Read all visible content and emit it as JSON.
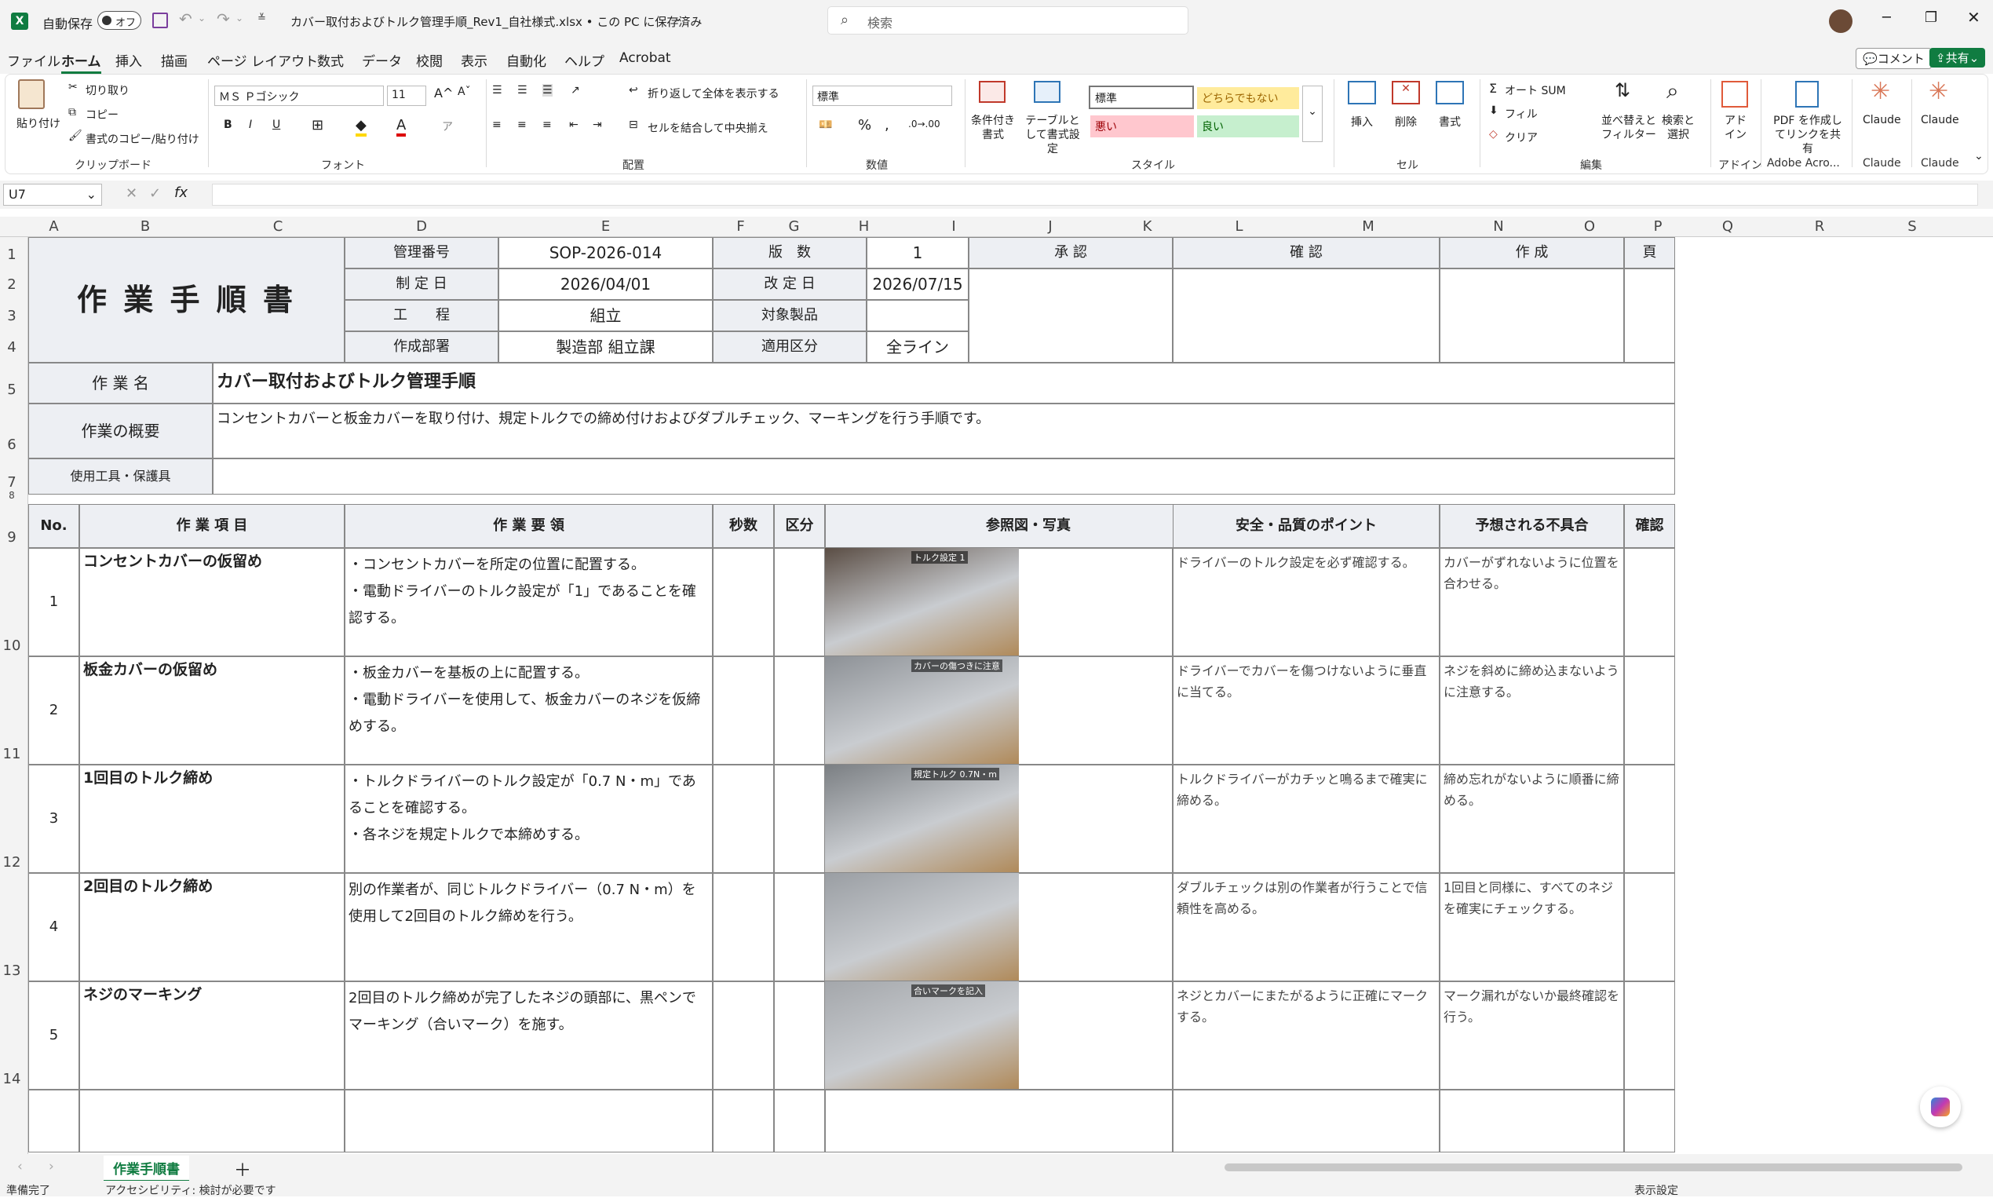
{
  "titlebar": {
    "autosave": "自動保存",
    "autosave_state": "オフ",
    "filename": "カバー取付およびトルク管理手順_Rev1_自社様式.xlsx • この PC に保存済み",
    "search_placeholder": "検索"
  },
  "menu": [
    "ファイル",
    "ホーム",
    "挿入",
    "描画",
    "ページ レイアウト",
    "数式",
    "データ",
    "校閲",
    "表示",
    "自動化",
    "ヘルプ",
    "Acrobat"
  ],
  "menu_right": {
    "comment": "コメント",
    "share": "共有"
  },
  "ribbon": {
    "clipboard": {
      "paste": "貼り付け",
      "cut": "切り取り",
      "copy": "コピー",
      "format_painter": "書式のコピー/貼り付け",
      "group": "クリップボード"
    },
    "font": {
      "name": "ＭＳ Ｐゴシック",
      "size": "11",
      "group": "フォント"
    },
    "align": {
      "wrap": "折り返して全体を表示する",
      "merge": "セルを結合して中央揃え",
      "group": "配置"
    },
    "number": {
      "format": "標準",
      "group": "数値"
    },
    "styles": {
      "cond": "条件付き書式",
      "table": "テーブルとして書式設定",
      "normal": "標準",
      "neutral": "どちらでもない",
      "bad": "悪い",
      "good": "良い",
      "group": "スタイル"
    },
    "cells": {
      "insert": "挿入",
      "delete": "削除",
      "format": "書式",
      "group": "セル"
    },
    "edit": {
      "autosum": "オート SUM",
      "fill": "フィル",
      "clear": "クリア",
      "sort": "並べ替えとフィルター",
      "find": "検索と選択",
      "group": "編集"
    },
    "addin": {
      "label": "アドイン",
      "group": "アドイン"
    },
    "pdf": {
      "label": "PDF を作成してリンクを共有",
      "group": "Adobe Acro..."
    },
    "claude1": {
      "label": "Claude",
      "group": "Claude"
    },
    "claude2": {
      "label": "Claude",
      "group": "Claude"
    }
  },
  "namebox": "U7",
  "columns": [
    "A",
    "B",
    "C",
    "D",
    "E",
    "F",
    "G",
    "H",
    "I",
    "J",
    "K",
    "L",
    "M",
    "N",
    "O",
    "P",
    "Q",
    "R",
    "S"
  ],
  "rows": [
    "1",
    "2",
    "3",
    "4",
    "5",
    "6",
    "7",
    "8",
    "9",
    "10",
    "11",
    "12",
    "13",
    "14"
  ],
  "header": {
    "doc_title": "作 業 手 順 書",
    "mgmt_no_label": "管理番号",
    "mgmt_no": "SOP-2026-014",
    "version_label": "版　数",
    "version": "1",
    "created_label": "制 定 日",
    "created": "2026/04/01",
    "revised_label": "改 定 日",
    "revised": "2026/07/15",
    "process_label": "工　　程",
    "process": "組立",
    "product_label": "対象製品",
    "product": "",
    "dept_label": "作成部署",
    "dept": "製造部 組立課",
    "scope_label": "適用区分",
    "scope": "全ライン",
    "approve": "承 認",
    "check": "確 認",
    "make": "作 成",
    "page": "頁"
  },
  "info": {
    "name_label": "作 業 名",
    "name": "カバー取付およびトルク管理手順",
    "summary_label": "作業の概要",
    "summary": "コンセントカバーと板金カバーを取り付け、規定トルクでの締め付けおよびダブルチェック、マーキングを行う手順です。",
    "tools_label": "使用工具・保護具",
    "tools": ""
  },
  "table_headers": {
    "no": "No.",
    "item": "作 業 項 目",
    "method": "作 業 要 領",
    "sec": "秒数",
    "kind": "区分",
    "ref": "参照図・写真",
    "safety": "安全・品質のポイント",
    "defect": "予想される不具合",
    "confirm": "確認"
  },
  "steps": [
    {
      "no": "1",
      "item": "コンセントカバーの仮留め",
      "method": "・コンセントカバーを所定の位置に配置する。\n・電動ドライバーのトルク設定が「1」であることを確認する。",
      "photo_caption": "トルク設定 1",
      "safety": "ドライバーのトルク設定を必ず確認する。",
      "defect": "カバーがずれないように位置を合わせる。"
    },
    {
      "no": "2",
      "item": "板金カバーの仮留め",
      "method": "・板金カバーを基板の上に配置する。\n・電動ドライバーを使用して、板金カバーのネジを仮締めする。",
      "photo_caption": "カバーの傷つきに注意",
      "safety": "ドライバーでカバーを傷つけないように垂直に当てる。",
      "defect": "ネジを斜めに締め込まないように注意する。"
    },
    {
      "no": "3",
      "item": "1回目のトルク締め",
      "method": "・トルクドライバーのトルク設定が「0.7 N・m」であることを確認する。\n・各ネジを規定トルクで本締めする。",
      "photo_caption": "規定トルク 0.7N・m",
      "safety": "トルクドライバーがカチッと鳴るまで確実に締める。",
      "defect": "締め忘れがないように順番に締める。"
    },
    {
      "no": "4",
      "item": "2回目のトルク締め",
      "method": "別の作業者が、同じトルクドライバー（0.7 N・m）を使用して2回目のトルク締めを行う。",
      "photo_caption": "",
      "safety": "ダブルチェックは別の作業者が行うことで信頼性を高める。",
      "defect": "1回目と同様に、すべてのネジを確実にチェックする。"
    },
    {
      "no": "5",
      "item": "ネジのマーキング",
      "method": "2回目のトルク締めが完了したネジの頭部に、黒ペンでマーキング（合いマーク）を施す。",
      "photo_caption": "合いマークを記入",
      "safety": "ネジとカバーにまたがるように正確にマークする。",
      "defect": "マーク漏れがないか最終確認を行う。"
    }
  ],
  "sheet_tab": "作業手順書",
  "status": {
    "ready": "準備完了",
    "accessibility": "アクセシビリティ: 検討が必要です",
    "display": "表示設定"
  }
}
